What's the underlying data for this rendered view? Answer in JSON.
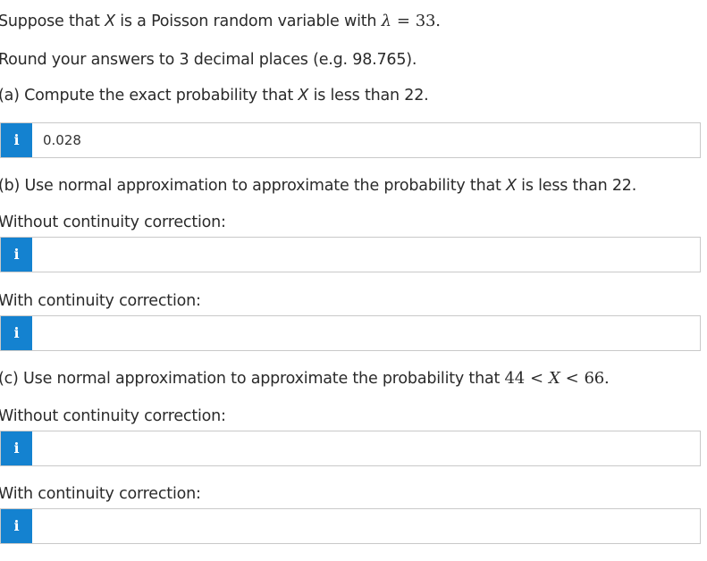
{
  "intro": {
    "text": "Suppose that ",
    "var": "X",
    "mid": " is a Poisson random variable with ",
    "lambda": "λ",
    "eq": "=",
    "value": "33."
  },
  "round_instruction": "Round your answers to 3 decimal places (e.g. 98.765).",
  "part_a": {
    "prefix": "(a) Compute the exact probability that ",
    "var": "X",
    "suffix": " is less than 22.",
    "answer": "0.028"
  },
  "part_b": {
    "prefix": "(b) Use normal approximation to approximate the probability that ",
    "var": "X",
    "suffix": " is less than 22.",
    "without_label": "Without continuity correction:",
    "without_answer": "",
    "with_label": "With continuity correction:",
    "with_answer": ""
  },
  "part_c": {
    "prefix": "(c) Use normal approximation to approximate the probability that ",
    "lower": "44",
    "lt1": "<",
    "var": "X",
    "lt2": "<",
    "upper": "66.",
    "without_label": "Without continuity correction:",
    "without_answer": "",
    "with_label": "With continuity correction:",
    "with_answer": ""
  },
  "info_glyph": "i",
  "icons": {
    "info": "info-icon"
  },
  "colors": {
    "info_badge": "#1482d0",
    "field_border": "#c9c9c9",
    "text": "#2a2a2a"
  }
}
